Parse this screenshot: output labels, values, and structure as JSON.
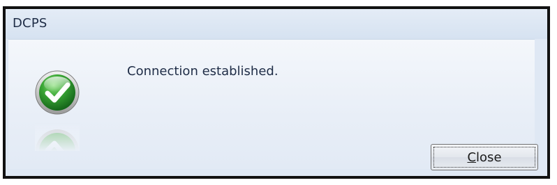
{
  "window": {
    "title": "DCPS"
  },
  "dialog": {
    "message": "Connection established.",
    "icon": "success-checkmark-icon",
    "close_button": {
      "label_mnemonic": "C",
      "label_rest": "lose"
    }
  },
  "colors": {
    "titlebar": "#dae5f3",
    "client_background": "#eef3f9",
    "text": "#1e2c46",
    "icon_green": "#3aa635",
    "frame_border": "#111111"
  }
}
